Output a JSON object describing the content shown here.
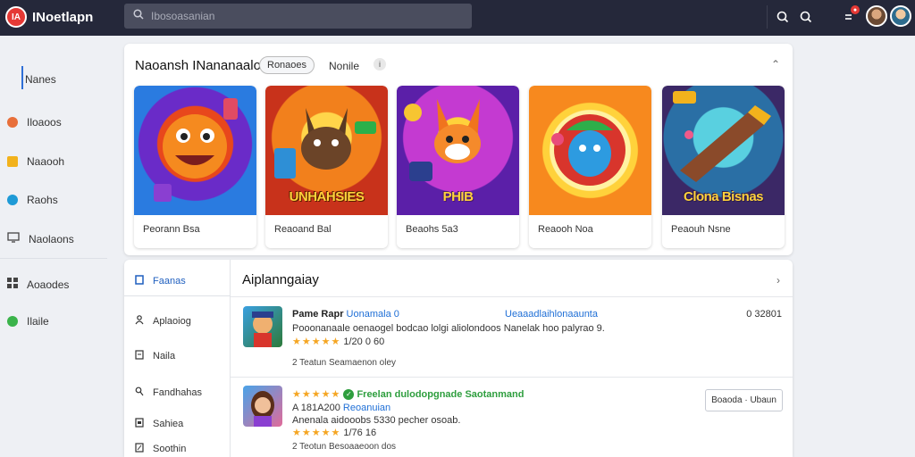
{
  "app": {
    "logo_text": "IA",
    "title": "INoetlapn"
  },
  "search": {
    "placeholder": "Ibosoasanian"
  },
  "leftnav": {
    "items": [
      {
        "label": "Nanes",
        "icon": "none"
      },
      {
        "label": "Iloaoos",
        "icon": "red-dot",
        "color": "#e86f3a"
      },
      {
        "label": "Naaooh",
        "icon": "yellow-square",
        "color": "#f2b21c"
      },
      {
        "label": "Raohs",
        "icon": "blue-dot",
        "color": "#1e9ad6"
      },
      {
        "label": "Naolaons",
        "icon": "monitor-icon"
      },
      {
        "label": "Aoaodes",
        "icon": "grid-icon"
      },
      {
        "label": "Ilaile",
        "icon": "green-dot",
        "color": "#3ab34a"
      }
    ]
  },
  "featured": {
    "title": "Naoansh INananaalo",
    "chip": "Ronaoes",
    "name": "Nonile",
    "info": "i",
    "tiles": [
      {
        "caption": "Peorann Bsa",
        "art_label": ""
      },
      {
        "caption": "Reaoand Bal",
        "art_label": "UNHAHSIES"
      },
      {
        "caption": "Beaohs 5a3",
        "art_label": "PHIB"
      },
      {
        "caption": "Reaooh Noa",
        "art_label": ""
      },
      {
        "caption": "Peaouh Nsne",
        "art_label": "Clona Bisnas"
      }
    ]
  },
  "list": {
    "title": "Aiplanngaiay",
    "subnav": [
      {
        "label": "Faanas",
        "icon": "square-outline-icon"
      },
      {
        "label": "Aplaoiog",
        "icon": "person-icon"
      },
      {
        "label": "Naila",
        "icon": "document-icon"
      },
      {
        "label": "Fandhahas",
        "icon": "key-icon"
      },
      {
        "label": "Sahiea",
        "icon": "box-icon"
      },
      {
        "label": "Soothin",
        "icon": "edit-icon"
      }
    ],
    "rows": [
      {
        "name": "Pame Rapr",
        "link": "Uonamala 0",
        "link2": "Ueaaadlaihlonaaunta",
        "right": "0 32801",
        "desc": "Pooonanaale oenaogel bodcao lolgi aliolondoos Nanelak hoo palyrao 9.",
        "rating": "1/20 0 60",
        "meta": "2 Teatun Seamaenon oley"
      },
      {
        "name": "Freelan dulodopgnade",
        "badge": "Saotanmand",
        "id": "A 181A200",
        "link": "Reoanuian",
        "desc": "Anenala aidooobs 5330 pecher osoab.",
        "rating": "1/76 16",
        "meta": "2 Teotun Besoaaeoon dos",
        "button": "Boaoda · Ubaun"
      }
    ]
  }
}
